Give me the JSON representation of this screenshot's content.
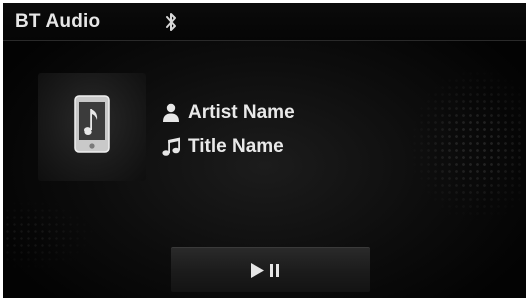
{
  "header": {
    "title": "BT Audio",
    "status_icon": "bluetooth-icon"
  },
  "album_art": {
    "icon": "phone-music-icon"
  },
  "track": {
    "artist_icon": "person-icon",
    "artist": "Artist Name",
    "title_icon": "music-note-icon",
    "title": "Title Name"
  },
  "controls": {
    "play_pause_icon": "play-pause-icon"
  },
  "colors": {
    "background": "#000000",
    "text": "#e9e9e9",
    "border": "#ffffff"
  }
}
